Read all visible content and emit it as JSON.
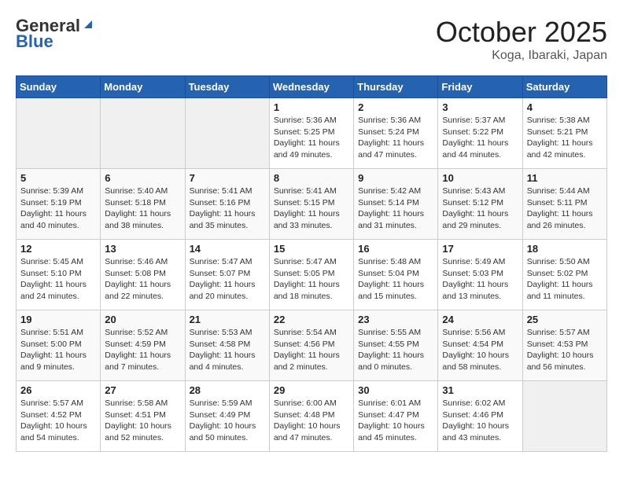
{
  "header": {
    "logo_general": "General",
    "logo_blue": "Blue",
    "month_title": "October 2025",
    "location": "Koga, Ibaraki, Japan"
  },
  "weekdays": [
    "Sunday",
    "Monday",
    "Tuesday",
    "Wednesday",
    "Thursday",
    "Friday",
    "Saturday"
  ],
  "weeks": [
    [
      {
        "day": "",
        "info": ""
      },
      {
        "day": "",
        "info": ""
      },
      {
        "day": "",
        "info": ""
      },
      {
        "day": "1",
        "info": "Sunrise: 5:36 AM\nSunset: 5:25 PM\nDaylight: 11 hours\nand 49 minutes."
      },
      {
        "day": "2",
        "info": "Sunrise: 5:36 AM\nSunset: 5:24 PM\nDaylight: 11 hours\nand 47 minutes."
      },
      {
        "day": "3",
        "info": "Sunrise: 5:37 AM\nSunset: 5:22 PM\nDaylight: 11 hours\nand 44 minutes."
      },
      {
        "day": "4",
        "info": "Sunrise: 5:38 AM\nSunset: 5:21 PM\nDaylight: 11 hours\nand 42 minutes."
      }
    ],
    [
      {
        "day": "5",
        "info": "Sunrise: 5:39 AM\nSunset: 5:19 PM\nDaylight: 11 hours\nand 40 minutes."
      },
      {
        "day": "6",
        "info": "Sunrise: 5:40 AM\nSunset: 5:18 PM\nDaylight: 11 hours\nand 38 minutes."
      },
      {
        "day": "7",
        "info": "Sunrise: 5:41 AM\nSunset: 5:16 PM\nDaylight: 11 hours\nand 35 minutes."
      },
      {
        "day": "8",
        "info": "Sunrise: 5:41 AM\nSunset: 5:15 PM\nDaylight: 11 hours\nand 33 minutes."
      },
      {
        "day": "9",
        "info": "Sunrise: 5:42 AM\nSunset: 5:14 PM\nDaylight: 11 hours\nand 31 minutes."
      },
      {
        "day": "10",
        "info": "Sunrise: 5:43 AM\nSunset: 5:12 PM\nDaylight: 11 hours\nand 29 minutes."
      },
      {
        "day": "11",
        "info": "Sunrise: 5:44 AM\nSunset: 5:11 PM\nDaylight: 11 hours\nand 26 minutes."
      }
    ],
    [
      {
        "day": "12",
        "info": "Sunrise: 5:45 AM\nSunset: 5:10 PM\nDaylight: 11 hours\nand 24 minutes."
      },
      {
        "day": "13",
        "info": "Sunrise: 5:46 AM\nSunset: 5:08 PM\nDaylight: 11 hours\nand 22 minutes."
      },
      {
        "day": "14",
        "info": "Sunrise: 5:47 AM\nSunset: 5:07 PM\nDaylight: 11 hours\nand 20 minutes."
      },
      {
        "day": "15",
        "info": "Sunrise: 5:47 AM\nSunset: 5:05 PM\nDaylight: 11 hours\nand 18 minutes."
      },
      {
        "day": "16",
        "info": "Sunrise: 5:48 AM\nSunset: 5:04 PM\nDaylight: 11 hours\nand 15 minutes."
      },
      {
        "day": "17",
        "info": "Sunrise: 5:49 AM\nSunset: 5:03 PM\nDaylight: 11 hours\nand 13 minutes."
      },
      {
        "day": "18",
        "info": "Sunrise: 5:50 AM\nSunset: 5:02 PM\nDaylight: 11 hours\nand 11 minutes."
      }
    ],
    [
      {
        "day": "19",
        "info": "Sunrise: 5:51 AM\nSunset: 5:00 PM\nDaylight: 11 hours\nand 9 minutes."
      },
      {
        "day": "20",
        "info": "Sunrise: 5:52 AM\nSunset: 4:59 PM\nDaylight: 11 hours\nand 7 minutes."
      },
      {
        "day": "21",
        "info": "Sunrise: 5:53 AM\nSunset: 4:58 PM\nDaylight: 11 hours\nand 4 minutes."
      },
      {
        "day": "22",
        "info": "Sunrise: 5:54 AM\nSunset: 4:56 PM\nDaylight: 11 hours\nand 2 minutes."
      },
      {
        "day": "23",
        "info": "Sunrise: 5:55 AM\nSunset: 4:55 PM\nDaylight: 11 hours\nand 0 minutes."
      },
      {
        "day": "24",
        "info": "Sunrise: 5:56 AM\nSunset: 4:54 PM\nDaylight: 10 hours\nand 58 minutes."
      },
      {
        "day": "25",
        "info": "Sunrise: 5:57 AM\nSunset: 4:53 PM\nDaylight: 10 hours\nand 56 minutes."
      }
    ],
    [
      {
        "day": "26",
        "info": "Sunrise: 5:57 AM\nSunset: 4:52 PM\nDaylight: 10 hours\nand 54 minutes."
      },
      {
        "day": "27",
        "info": "Sunrise: 5:58 AM\nSunset: 4:51 PM\nDaylight: 10 hours\nand 52 minutes."
      },
      {
        "day": "28",
        "info": "Sunrise: 5:59 AM\nSunset: 4:49 PM\nDaylight: 10 hours\nand 50 minutes."
      },
      {
        "day": "29",
        "info": "Sunrise: 6:00 AM\nSunset: 4:48 PM\nDaylight: 10 hours\nand 47 minutes."
      },
      {
        "day": "30",
        "info": "Sunrise: 6:01 AM\nSunset: 4:47 PM\nDaylight: 10 hours\nand 45 minutes."
      },
      {
        "day": "31",
        "info": "Sunrise: 6:02 AM\nSunset: 4:46 PM\nDaylight: 10 hours\nand 43 minutes."
      },
      {
        "day": "",
        "info": ""
      }
    ]
  ]
}
